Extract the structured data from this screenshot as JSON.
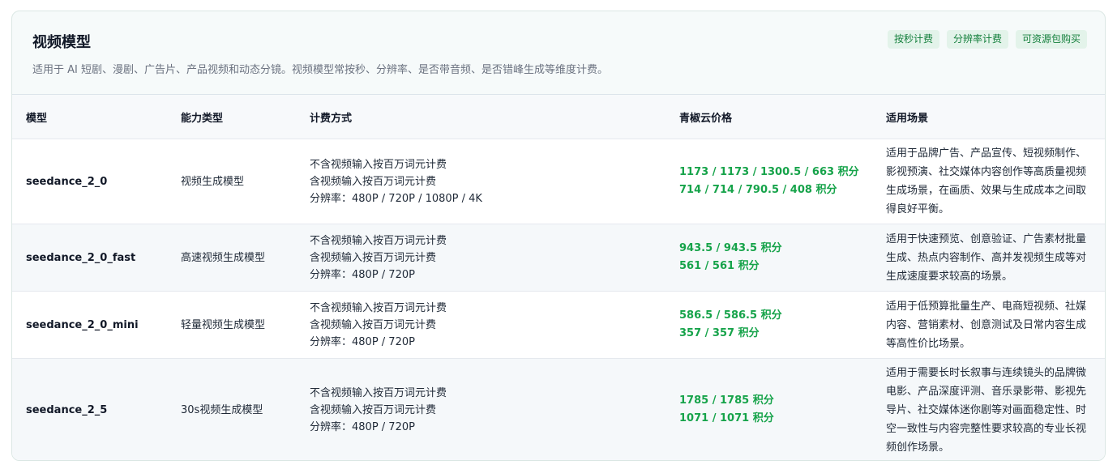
{
  "header": {
    "title": "视频模型",
    "subtitle": "适用于 AI 短剧、漫剧、广告片、产品视频和动态分镜。视频模型常按秒、分辨率、是否带音频、是否错峰生成等维度计费。",
    "tags": [
      "按秒计费",
      "分辨率计费",
      "可资源包购买"
    ]
  },
  "table": {
    "columns": [
      "模型",
      "能力类型",
      "计费方式",
      "青椒云价格",
      "适用场景"
    ],
    "rows": [
      {
        "model": "seedance_2_0",
        "type": "视频生成模型",
        "billing": [
          "不含视频输入按百万词元计费",
          "含视频输入按百万词元计费",
          "分辨率：480P / 720P / 1080P / 4K"
        ],
        "price": [
          "1173 / 1173 / 1300.5 / 663 积分",
          "714 / 714 / 790.5 / 408 积分"
        ],
        "scene": "适用于品牌广告、产品宣传、短视频制作、影视预演、社交媒体内容创作等高质量视频生成场景，在画质、效果与生成成本之间取得良好平衡。"
      },
      {
        "model": "seedance_2_0_fast",
        "type": "高速视频生成模型",
        "billing": [
          "不含视频输入按百万词元计费",
          "含视频输入按百万词元计费",
          "分辨率：480P / 720P"
        ],
        "price": [
          "943.5 / 943.5 积分",
          "561 / 561 积分"
        ],
        "scene": "适用于快速预览、创意验证、广告素材批量生成、热点内容制作、高并发视频生成等对生成速度要求较高的场景。"
      },
      {
        "model": "seedance_2_0_mini",
        "type": "轻量视频生成模型",
        "billing": [
          "不含视频输入按百万词元计费",
          "含视频输入按百万词元计费",
          "分辨率：480P / 720P"
        ],
        "price": [
          "586.5 / 586.5 积分",
          "357 / 357 积分"
        ],
        "scene": "适用于低预算批量生产、电商短视频、社媒内容、营销素材、创意测试及日常内容生成等高性价比场景。"
      },
      {
        "model": "seedance_2_5",
        "type": "30s视频生成模型",
        "billing": [
          "不含视频输入按百万词元计费",
          "含视频输入按百万词元计费",
          "分辨率：480P / 720P"
        ],
        "price": [
          "1785 / 1785 积分",
          "1071 / 1071 积分"
        ],
        "scene": "适用于需要长时长叙事与连续镜头的品牌微电影、产品深度评测、音乐录影带、影视先导片、社交媒体迷你剧等对画面稳定性、时空一致性与内容完整性要求较高的专业长视频创作场景。"
      }
    ]
  }
}
